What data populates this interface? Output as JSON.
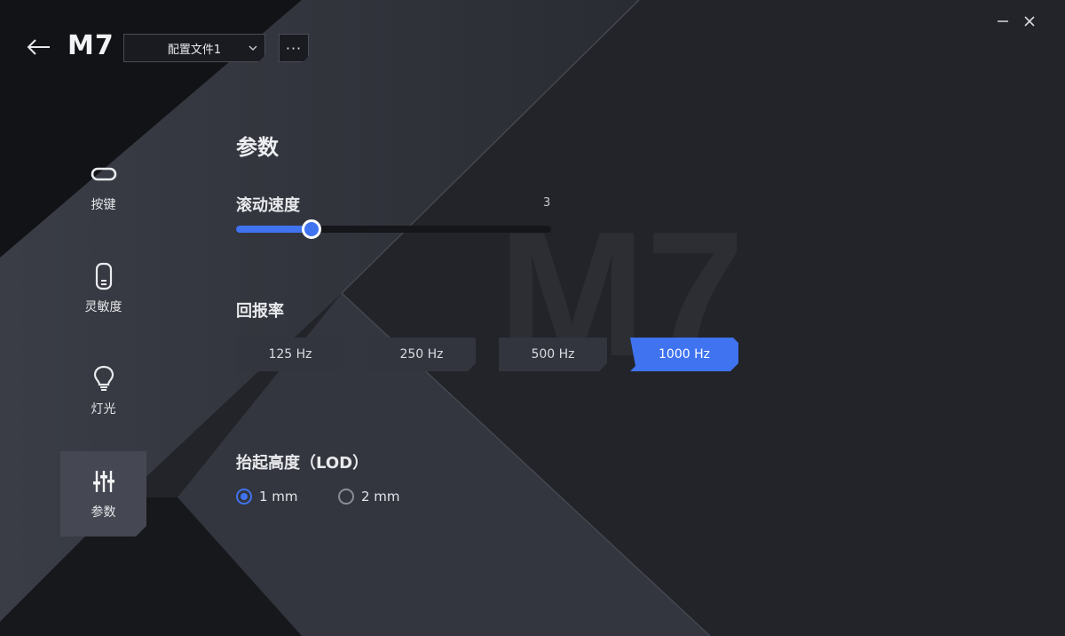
{
  "app": {
    "title": "M7",
    "watermark": "M7"
  },
  "header": {
    "profile_selected": "配置文件1",
    "more_label": "···"
  },
  "sidebar": {
    "items": [
      {
        "label": "按键",
        "icon": "button-icon",
        "active": false
      },
      {
        "label": "灵敏度",
        "icon": "mouse-icon",
        "active": false
      },
      {
        "label": "灯光",
        "icon": "lightbulb-icon",
        "active": false
      },
      {
        "label": "参数",
        "icon": "sliders-icon",
        "active": true
      }
    ]
  },
  "main": {
    "title": "参数",
    "scroll_speed": {
      "label": "滚动速度",
      "value": "3",
      "fraction": 0.24
    },
    "polling_rate": {
      "label": "回报率",
      "options": [
        "125 Hz",
        "250 Hz",
        "500 Hz",
        "1000 Hz"
      ],
      "selected": "1000 Hz"
    },
    "lift_off": {
      "label": "抬起高度（LOD）",
      "options": [
        "1 mm",
        "2 mm"
      ],
      "selected": "1 mm"
    }
  },
  "colors": {
    "accent": "#3f73f0",
    "background": "#202228",
    "button": "#32353d"
  }
}
